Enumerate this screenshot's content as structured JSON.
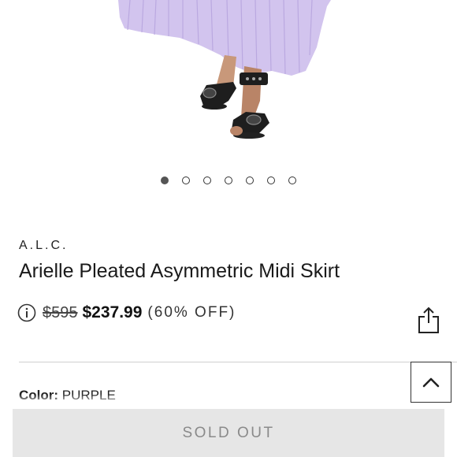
{
  "product": {
    "image_alt_icon": "product-photo",
    "carousel": {
      "total": 7,
      "active_index": 0
    },
    "brand": "A.L.C.",
    "title": "Arielle Pleated Asymmetric Midi Skirt",
    "price": {
      "info_icon": "info-icon",
      "original": "$595",
      "sale": "$237.99",
      "discount": "(60% OFF)"
    },
    "share_icon": "share-icon",
    "color": {
      "label": "Color:",
      "value": "PURPLE"
    }
  },
  "back_to_top_icon": "chevron-up-icon",
  "cta": {
    "label": "SOLD OUT"
  },
  "colors": {
    "skirt": "#cfc0ec",
    "sandal": "#1e1e1e",
    "button_bg": "#e6e6e6",
    "button_text": "#8a8a8a"
  }
}
